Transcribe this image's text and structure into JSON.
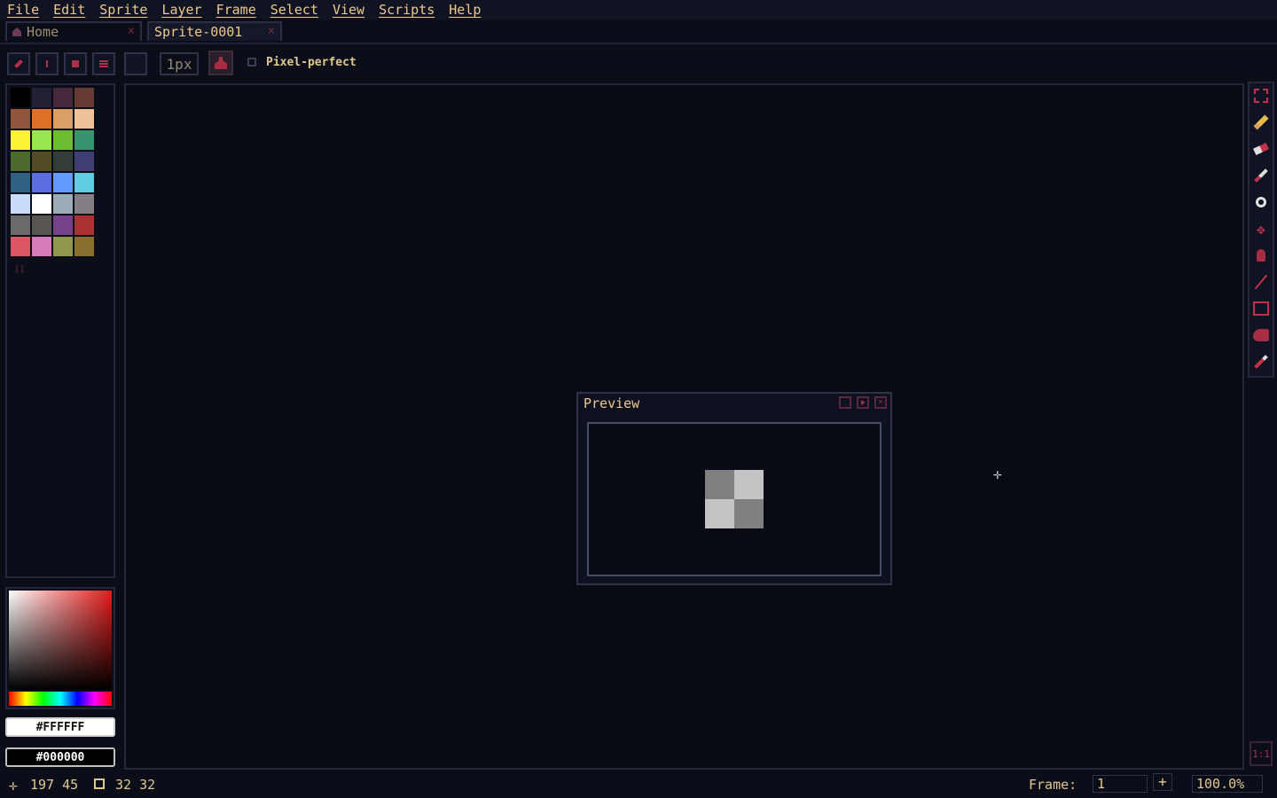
{
  "menu": [
    "File",
    "Edit",
    "Sprite",
    "Layer",
    "Frame",
    "Select",
    "View",
    "Scripts",
    "Help"
  ],
  "tabs": [
    {
      "label": "Home",
      "close": "×",
      "icon": "home-icon"
    },
    {
      "label": "Sprite-0001",
      "close": "×"
    }
  ],
  "toolbar": {
    "brush_size": "1px",
    "pixel_perfect_label": "Pixel-perfect",
    "pixel_perfect_checked": false
  },
  "palette": {
    "colors": [
      "#000000",
      "#222034",
      "#45283c",
      "#663931",
      "#8f563b",
      "#df7126",
      "#d9a066",
      "#eec39a",
      "#fbf236",
      "#99e550",
      "#6abe30",
      "#37946e",
      "#4b692f",
      "#524b24",
      "#323c39",
      "#3f3f74",
      "#306082",
      "#5b6ee1",
      "#639bff",
      "#5fcde4",
      "#cbdbfc",
      "#ffffff",
      "#9badb7",
      "#847e87",
      "#696a6a",
      "#595652",
      "#76428a",
      "#ac3232",
      "#d95763",
      "#d77bba",
      "#8f974a",
      "#8a6f30"
    ]
  },
  "color": {
    "foreground": "#FFFFFF",
    "background": "#000000"
  },
  "preview": {
    "title": "Preview"
  },
  "tools": [
    "marquee-icon",
    "pencil-icon",
    "eraser-icon",
    "eyedropper-icon",
    "zoom-icon",
    "move-icon",
    "paint-bucket-icon",
    "line-icon",
    "rectangle-icon",
    "curve-icon",
    "blur-icon"
  ],
  "status": {
    "cursor_pos": "197 45",
    "sprite_size": "32 32",
    "frame_label": "Frame:",
    "frame_value": "1",
    "zoom": "100.0%",
    "ratio": "1:1"
  }
}
